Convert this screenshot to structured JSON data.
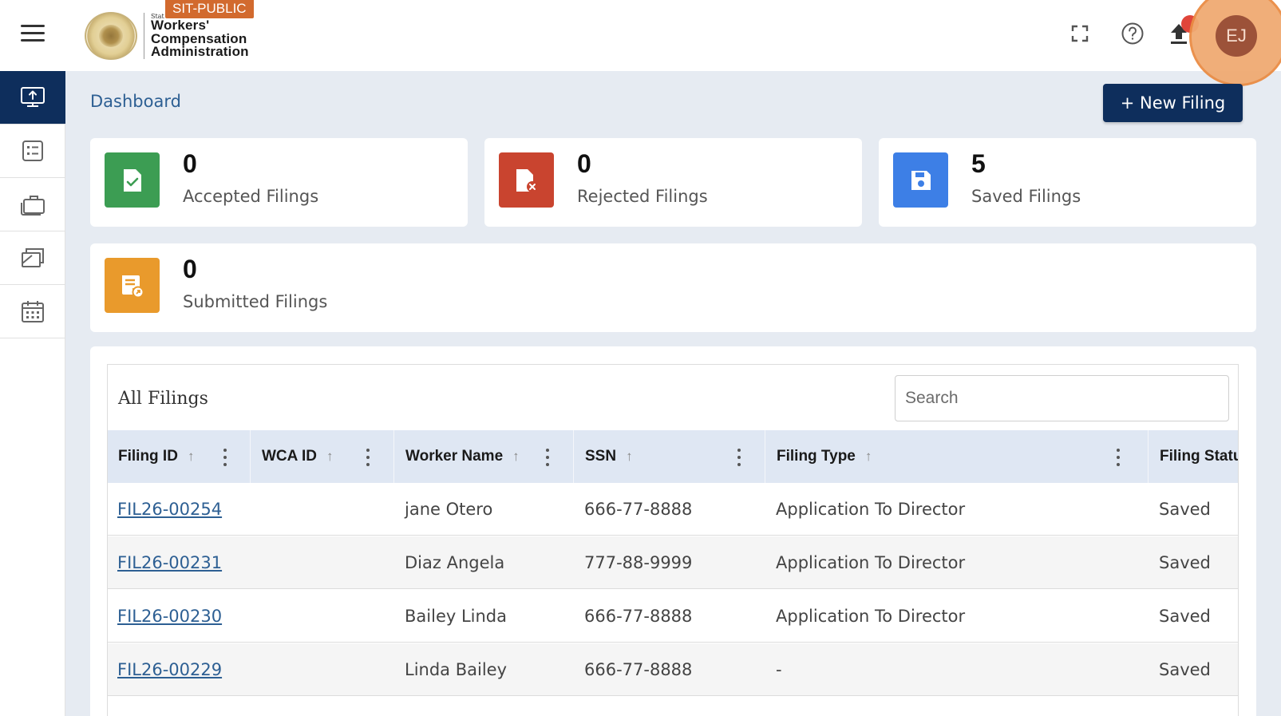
{
  "header": {
    "env_badge": "SIT-PUBLIC",
    "logo_small": "Stat",
    "logo_line1": "Workers'",
    "logo_line2": "Compensation",
    "logo_line3": "Administration",
    "avatar_initials": "EJ"
  },
  "sidebar": {
    "items": [
      {
        "icon": "monitor-upload-icon",
        "active": true
      },
      {
        "icon": "checklist-icon",
        "active": false
      },
      {
        "icon": "briefcase-icon",
        "active": false
      },
      {
        "icon": "documents-icon",
        "active": false
      },
      {
        "icon": "calendar-icon",
        "active": false
      }
    ]
  },
  "breadcrumb": "Dashboard",
  "new_filing_label": "+ New Filing",
  "stats": [
    {
      "count": "0",
      "label": "Accepted Filings",
      "color": "#3c9d53",
      "icon": "file-check-icon"
    },
    {
      "count": "0",
      "label": "Rejected Filings",
      "color": "#c9442f",
      "icon": "file-x-icon"
    },
    {
      "count": "5",
      "label": "Saved Filings",
      "color": "#3d7fe6",
      "icon": "save-icon"
    },
    {
      "count": "0",
      "label": "Submitted Filings",
      "color": "#e99a2c",
      "icon": "submit-doc-icon"
    }
  ],
  "table": {
    "title": "All Filings",
    "search_placeholder": "Search",
    "columns": [
      "Filing ID",
      "WCA ID",
      "Worker Name",
      "SSN",
      "Filing Type",
      "Filing Statu"
    ],
    "rows": [
      {
        "filing_id": "FIL26-00254",
        "wca_id": "",
        "worker_name": "jane Otero",
        "ssn": "666-77-8888",
        "filing_type": "Application To Director",
        "status": "Saved"
      },
      {
        "filing_id": "FIL26-00231",
        "wca_id": "",
        "worker_name": "Diaz Angela",
        "ssn": "777-88-9999",
        "filing_type": "Application To Director",
        "status": "Saved"
      },
      {
        "filing_id": "FIL26-00230",
        "wca_id": "",
        "worker_name": "Bailey Linda",
        "ssn": "666-77-8888",
        "filing_type": "Application To Director",
        "status": "Saved"
      },
      {
        "filing_id": "FIL26-00229",
        "wca_id": "",
        "worker_name": "Linda Bailey",
        "ssn": "666-77-8888",
        "filing_type": "-",
        "status": "Saved"
      }
    ]
  },
  "colors": {
    "navy": "#0e2e5c",
    "link": "#2d5f93",
    "background": "#e6ebf2",
    "header_row": "#dfe7f3",
    "badge": "#d26a2e"
  }
}
